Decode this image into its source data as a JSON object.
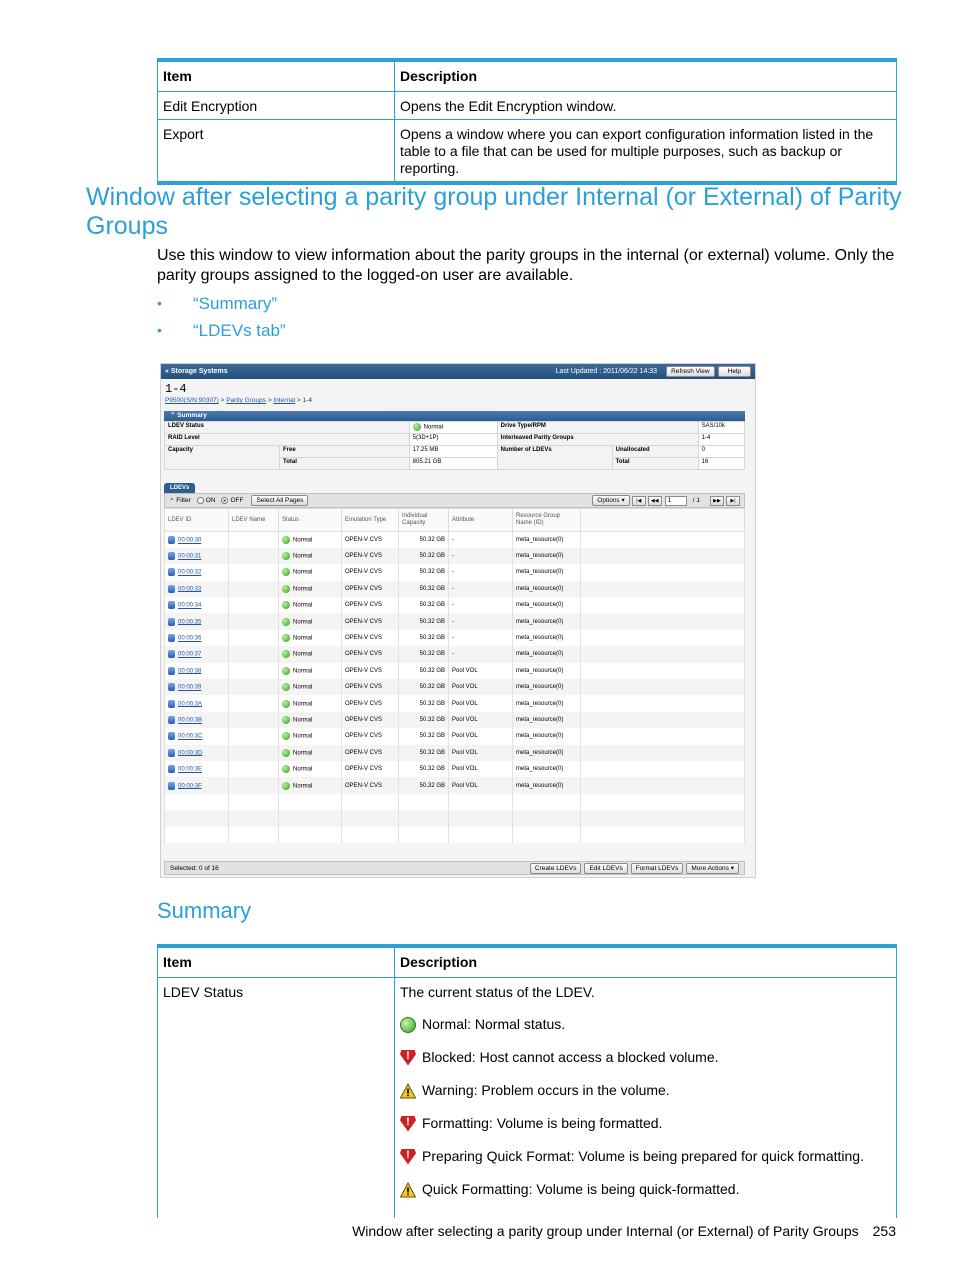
{
  "top_table": {
    "headers": [
      "Item",
      "Description"
    ],
    "rows": [
      [
        "Edit Encryption",
        "Opens the Edit Encryption window."
      ],
      [
        "Export",
        "Opens a window where you can export configuration information listed in the table to a file that can be used for multiple purposes, such as backup or reporting."
      ]
    ]
  },
  "section_title": "Window after selecting a parity group under Internal (or External) of Parity Groups",
  "intro": "Use this window to view information about the parity groups in the internal (or external) volume. Only the parity groups assigned to the logged-on user are available.",
  "links": [
    "“Summary”",
    "“LDEVs tab”"
  ],
  "screenshot": {
    "title": "« Storage Systems",
    "last_updated": "Last Updated : 2011/06/22 14:33",
    "refresh": "Refresh View",
    "help": "Help",
    "page_title": "1-4",
    "crumbs": [
      "P9500(S/N:90307)",
      ">",
      "Parity Groups",
      ">",
      "Internal",
      "> 1-4"
    ],
    "summary_label": "Summary",
    "summary": {
      "ldev_status_label": "LDEV Status",
      "ldev_status": "Normal",
      "raid_label": "RAID Level",
      "raid": "5(3D+1P)",
      "capacity_label": "Capacity",
      "free_label": "Free",
      "free": "17.25 MB",
      "total_label": "Total",
      "total": "805.21 GB",
      "drive_label": "Drive Type/RPM",
      "drive": "SAS/10k",
      "interleaved_label": "Interleaved Parity Groups",
      "interleaved": "1-4",
      "num_ldevs_label": "Number of LDEVs",
      "unalloc_label": "Unallocated",
      "unalloc": "0",
      "ldev_total_label": "Total",
      "ldev_total": "16"
    },
    "tab": "LDEVs",
    "filter": "Filter",
    "on": "ON",
    "off": "OFF",
    "select_all": "Select All Pages",
    "options": "Options",
    "page_num": "1",
    "page_of": "/ 1",
    "columns": [
      "LDEV ID",
      "LDEV Name",
      "Status",
      "Emulation Type",
      "Individual Capacity",
      "Attribute",
      "Resource Group Name (ID)"
    ],
    "rows": [
      {
        "id": "00:00:30",
        "status": "Normal",
        "emu": "OPEN-V CVS",
        "cap": "50.32 GB",
        "attr": "-",
        "rg": "meta_resource(0)"
      },
      {
        "id": "00:00:31",
        "status": "Normal",
        "emu": "OPEN-V CVS",
        "cap": "50.32 GB",
        "attr": "-",
        "rg": "meta_resource(0)"
      },
      {
        "id": "00:00:32",
        "status": "Normal",
        "emu": "OPEN-V CVS",
        "cap": "50.32 GB",
        "attr": "-",
        "rg": "meta_resource(0)"
      },
      {
        "id": "00:00:33",
        "status": "Normal",
        "emu": "OPEN-V CVS",
        "cap": "50.32 GB",
        "attr": "-",
        "rg": "meta_resource(0)"
      },
      {
        "id": "00:00:34",
        "status": "Normal",
        "emu": "OPEN-V CVS",
        "cap": "50.32 GB",
        "attr": "-",
        "rg": "meta_resource(0)"
      },
      {
        "id": "00:00:35",
        "status": "Normal",
        "emu": "OPEN-V CVS",
        "cap": "50.32 GB",
        "attr": "-",
        "rg": "meta_resource(0)"
      },
      {
        "id": "00:00:36",
        "status": "Normal",
        "emu": "OPEN-V CVS",
        "cap": "50.32 GB",
        "attr": "-",
        "rg": "meta_resource(0)"
      },
      {
        "id": "00:00:37",
        "status": "Normal",
        "emu": "OPEN-V CVS",
        "cap": "50.32 GB",
        "attr": "-",
        "rg": "meta_resource(0)"
      },
      {
        "id": "00:00:38",
        "status": "Normal",
        "emu": "OPEN-V CVS",
        "cap": "50.32 GB",
        "attr": "Pool VOL",
        "rg": "meta_resource(0)"
      },
      {
        "id": "00:00:39",
        "status": "Normal",
        "emu": "OPEN-V CVS",
        "cap": "50.32 GB",
        "attr": "Pool VOL",
        "rg": "meta_resource(0)"
      },
      {
        "id": "00:00:3A",
        "status": "Normal",
        "emu": "OPEN-V CVS",
        "cap": "50.32 GB",
        "attr": "Pool VOL",
        "rg": "meta_resource(0)"
      },
      {
        "id": "00:00:3B",
        "status": "Normal",
        "emu": "OPEN-V CVS",
        "cap": "50.32 GB",
        "attr": "Pool VOL",
        "rg": "meta_resource(0)"
      },
      {
        "id": "00:00:3C",
        "status": "Normal",
        "emu": "OPEN-V CVS",
        "cap": "50.32 GB",
        "attr": "Pool VOL",
        "rg": "meta_resource(0)"
      },
      {
        "id": "00:00:3D",
        "status": "Normal",
        "emu": "OPEN-V CVS",
        "cap": "50.32 GB",
        "attr": "Pool VOL",
        "rg": "meta_resource(0)"
      },
      {
        "id": "00:00:3E",
        "status": "Normal",
        "emu": "OPEN-V CVS",
        "cap": "50.32 GB",
        "attr": "Pool VOL",
        "rg": "meta_resource(0)"
      },
      {
        "id": "00:00:3F",
        "status": "Normal",
        "emu": "OPEN-V CVS",
        "cap": "50.32 GB",
        "attr": "Pool VOL",
        "rg": "meta_resource(0)"
      }
    ],
    "blank_rows": 3,
    "selected": "Selected:  0    of  16",
    "buttons": [
      "Create LDEVs",
      "Edit LDEVs",
      "Format LDEVs",
      "More Actions"
    ]
  },
  "summary_heading": "Summary",
  "summary_table": {
    "headers": [
      "Item",
      "Description"
    ],
    "item": "LDEV Status",
    "lead": "The current status of the LDEV.",
    "statuses": [
      {
        "icon": "ok",
        "text": "Normal: Normal status."
      },
      {
        "icon": "err",
        "text": "Blocked: Host cannot access a blocked volume."
      },
      {
        "icon": "warn",
        "text": "Warning: Problem occurs in the volume."
      },
      {
        "icon": "err",
        "text": "Formatting: Volume is being formatted."
      },
      {
        "icon": "err",
        "text": "Preparing Quick Format: Volume is being prepared for quick formatting."
      },
      {
        "icon": "warn",
        "text": "Quick Formatting: Volume is being quick-formatted."
      }
    ]
  },
  "footer": {
    "text": "Window after selecting a parity group under Internal (or External) of Parity Groups",
    "page": "253"
  },
  "colors": {
    "accent": "#2b9fd8",
    "normal": "#2e9d1c",
    "error": "#cc2222",
    "warning": "#f0c020"
  }
}
